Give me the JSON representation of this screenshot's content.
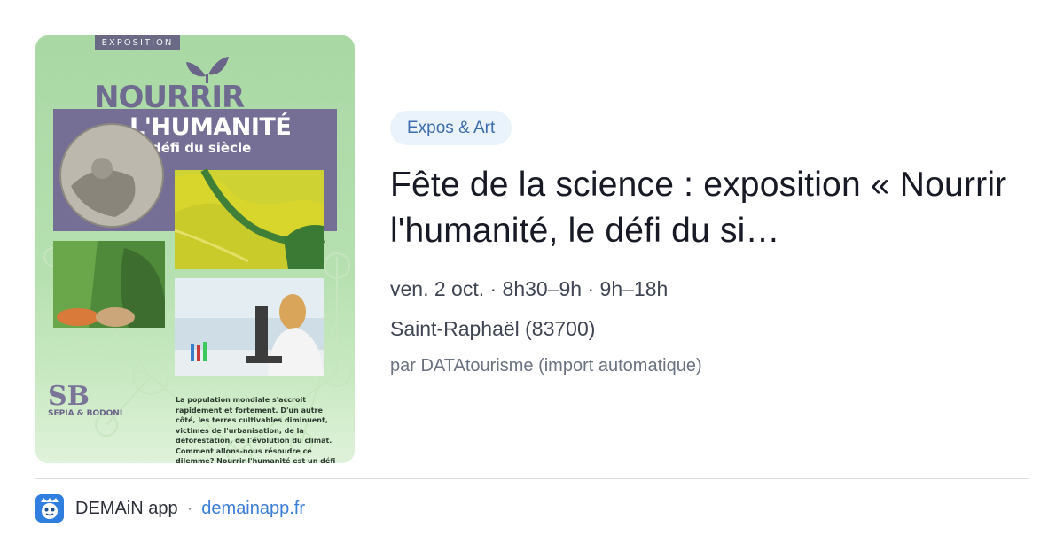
{
  "poster": {
    "exposition_label": "EXPOSITION",
    "title_line_1": "NOURRIR",
    "title_line_2": "L'HUMANITÉ",
    "subtitle": "Le défi du siècle",
    "body_text": "La population mondiale s'accroit rapidement et fortement. D'un autre côté, les terres cultivables diminuent, victimes de l'urbanisation, de la déforestation, de l'évolution du climat. Comment allons-nous résoudre ce dilemme? Nourrir l'humanité est un défi majeur que nous devons relever pour le bonheur de chacun.",
    "publisher_monogram": "SB",
    "publisher_name": "SEPIA & BODONI"
  },
  "event": {
    "category": "Expos & Art",
    "title": "Fête de la science : exposition « Nourrir l'humanité, le défi du si…",
    "datetime": "ven. 2 oct. · 8h30–9h · 9h–18h",
    "location": "Saint-Raphaël (83700)",
    "source": "par DATAtourisme (import automatique)"
  },
  "footer": {
    "app_name": "DEMAiN app",
    "separator": "·",
    "site": "demainapp.fr",
    "logo_icon": "demain-app-logo-icon"
  },
  "colors": {
    "tag_bg": "#eaf2fc",
    "tag_text": "#3d6dac",
    "link": "#3b7dd8",
    "logo": "#2f7ee0",
    "poster_green": "#b6e0b0",
    "poster_purple": "#756f95"
  }
}
